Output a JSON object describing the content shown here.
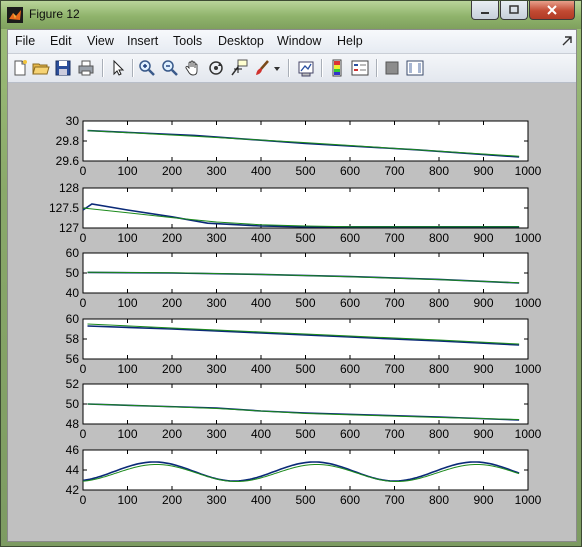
{
  "window": {
    "title": "Figure 12"
  },
  "menu": [
    "File",
    "Edit",
    "View",
    "Insert",
    "Tools",
    "Desktop",
    "Window",
    "Help"
  ],
  "toolbar_icons": [
    "new-figure-icon",
    "open-file-icon",
    "save-icon",
    "print-icon",
    "edit-plot-arrow-icon",
    "zoom-in-icon",
    "zoom-out-icon",
    "pan-hand-icon",
    "rotate-3d-icon",
    "data-cursor-icon",
    "brush-icon",
    "brush-dropdown-icon",
    "link-plot-icon",
    "insert-colorbar-icon",
    "insert-legend-icon",
    "hide-plot-tools-icon",
    "show-plot-tools-icon"
  ],
  "colors": {
    "series_data": "#0b2a78",
    "series_fit": "#1c8a1c",
    "axes_bg": "#ffffff",
    "figure_bg": "#c0c0c0"
  },
  "chart_data": [
    {
      "type": "line",
      "xlim": [
        0,
        1000
      ],
      "ylim": [
        29.5,
        30
      ],
      "yticks": [
        "30",
        "29.8",
        "29.6"
      ],
      "xticks": [
        "0",
        "100",
        "200",
        "300",
        "400",
        "500",
        "600",
        "700",
        "800",
        "900",
        "1000"
      ],
      "series": [
        {
          "x": [
            10,
            250,
            500,
            750,
            980
          ],
          "values": [
            29.88,
            29.82,
            29.72,
            29.64,
            29.55
          ]
        },
        {
          "x": [
            10,
            250,
            500,
            750,
            980
          ],
          "values": [
            29.88,
            29.81,
            29.73,
            29.64,
            29.56
          ]
        }
      ]
    },
    {
      "type": "line",
      "xlim": [
        0,
        1000
      ],
      "ylim": [
        127,
        128
      ],
      "yticks": [
        "128",
        "127.5",
        "127"
      ],
      "xticks": [
        "0",
        "100",
        "200",
        "300",
        "400",
        "500",
        "600",
        "700",
        "800",
        "900",
        "1000"
      ],
      "series": [
        {
          "x": [
            0,
            20,
            100,
            200,
            280,
            400,
            500,
            600,
            700,
            800,
            980
          ],
          "values": [
            127.45,
            127.6,
            127.45,
            127.28,
            127.12,
            127.05,
            127.03,
            127.03,
            127.03,
            127.03,
            127.03
          ]
        },
        {
          "x": [
            0,
            100,
            200,
            300,
            400,
            500,
            600,
            700,
            800,
            980
          ],
          "values": [
            127.5,
            127.38,
            127.26,
            127.15,
            127.08,
            127.05,
            127.03,
            127.03,
            127.03,
            127.03
          ]
        }
      ]
    },
    {
      "type": "line",
      "xlim": [
        0,
        1000
      ],
      "ylim": [
        40,
        60
      ],
      "yticks": [
        "60",
        "50",
        "40"
      ],
      "xticks": [
        "0",
        "100",
        "200",
        "300",
        "400",
        "500",
        "600",
        "700",
        "800",
        "900",
        "1000"
      ],
      "series": [
        {
          "x": [
            10,
            200,
            400,
            600,
            800,
            980
          ],
          "values": [
            50.3,
            50.0,
            49.3,
            48.2,
            46.8,
            45.0
          ]
        },
        {
          "x": [
            10,
            200,
            400,
            600,
            800,
            980
          ],
          "values": [
            50.4,
            50.1,
            49.3,
            48.1,
            46.7,
            45.1
          ]
        }
      ]
    },
    {
      "type": "line",
      "xlim": [
        0,
        1000
      ],
      "ylim": [
        56,
        60
      ],
      "yticks": [
        "60",
        "58",
        "56"
      ],
      "xticks": [
        "0",
        "100",
        "200",
        "300",
        "400",
        "500",
        "600",
        "700",
        "800",
        "900",
        "1000"
      ],
      "series": [
        {
          "x": [
            10,
            200,
            400,
            600,
            800,
            980
          ],
          "values": [
            59.3,
            59.0,
            58.6,
            58.2,
            57.8,
            57.4
          ]
        },
        {
          "x": [
            10,
            200,
            400,
            600,
            800,
            980
          ],
          "values": [
            59.5,
            59.1,
            58.7,
            58.3,
            57.9,
            57.5
          ]
        }
      ]
    },
    {
      "type": "line",
      "xlim": [
        0,
        1000
      ],
      "ylim": [
        48,
        52
      ],
      "yticks": [
        "52",
        "50",
        "48"
      ],
      "xticks": [
        "0",
        "100",
        "200",
        "300",
        "400",
        "500",
        "600",
        "700",
        "800",
        "900",
        "1000"
      ],
      "series": [
        {
          "x": [
            10,
            150,
            300,
            400,
            500,
            650,
            800,
            980
          ],
          "values": [
            50.0,
            49.8,
            49.6,
            49.3,
            49.1,
            48.9,
            48.7,
            48.4
          ]
        },
        {
          "x": [
            10,
            150,
            300,
            400,
            500,
            650,
            800,
            980
          ],
          "values": [
            50.0,
            49.8,
            49.55,
            49.3,
            49.05,
            48.85,
            48.65,
            48.45
          ]
        }
      ]
    },
    {
      "type": "line",
      "xlim": [
        0,
        1000
      ],
      "ylim": [
        42,
        46
      ],
      "yticks": [
        "46",
        "44",
        "42"
      ],
      "xticks": [
        "0",
        "100",
        "200",
        "300",
        "400",
        "500",
        "600",
        "700",
        "800",
        "900",
        "1000"
      ],
      "series": [
        {
          "wave": {
            "mean": 43.85,
            "amp": 0.95,
            "period": 360,
            "phase_x": 70,
            "x0": 0,
            "x1": 980
          }
        },
        {
          "wave": {
            "mean": 43.7,
            "amp": 0.85,
            "period": 360,
            "phase_x": 75,
            "x0": 0,
            "x1": 980
          }
        }
      ]
    }
  ]
}
